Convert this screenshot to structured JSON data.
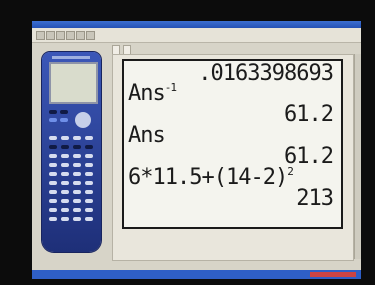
{
  "calculator_screen": {
    "lines": [
      {
        "text": ".0163398693",
        "align": "right"
      },
      {
        "text": "Ans",
        "sup": "-1",
        "align": "left"
      },
      {
        "text": "61.2",
        "align": "right"
      },
      {
        "text": "Ans",
        "align": "left"
      },
      {
        "text": "61.2",
        "align": "right"
      },
      {
        "text": "6*11.5+(14-2)",
        "sup": "2",
        "align": "left"
      },
      {
        "text": "213",
        "align": "right"
      }
    ]
  },
  "colors": {
    "background": "#0c0c0c",
    "window": "#d7d4c8",
    "calculator_body": "#2a43a0",
    "lcd": "#f4f4ee",
    "taskbar": "#2f5fc6"
  },
  "icons": [
    "calculator-image",
    "scroll-bar"
  ]
}
